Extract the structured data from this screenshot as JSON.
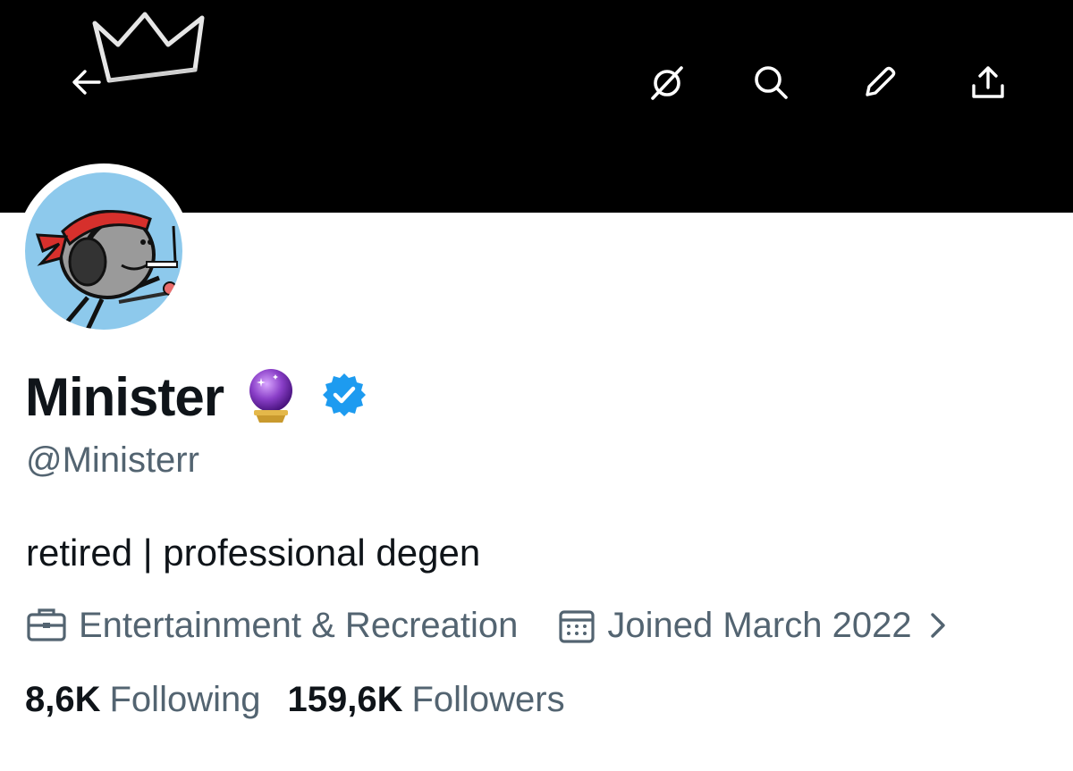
{
  "profile": {
    "name": "Minister",
    "handle": "@Ministerr",
    "bio": "retired | professional degen",
    "category": "Entertainment & Recreation",
    "joined": "Joined March 2022"
  },
  "stats": {
    "following_count": "8,6K",
    "following_label": "Following",
    "followers_count": "159,6K",
    "followers_label": "Followers"
  },
  "header_icons": [
    "arrow-left-icon",
    "grok-icon",
    "search-icon",
    "pencil-icon",
    "share-icon"
  ],
  "colors": {
    "banner": "#000000",
    "text_primary": "#0f1419",
    "text_secondary": "#536471",
    "verified": "#1d9bf0",
    "avatar_background": "#8dc9ec"
  }
}
